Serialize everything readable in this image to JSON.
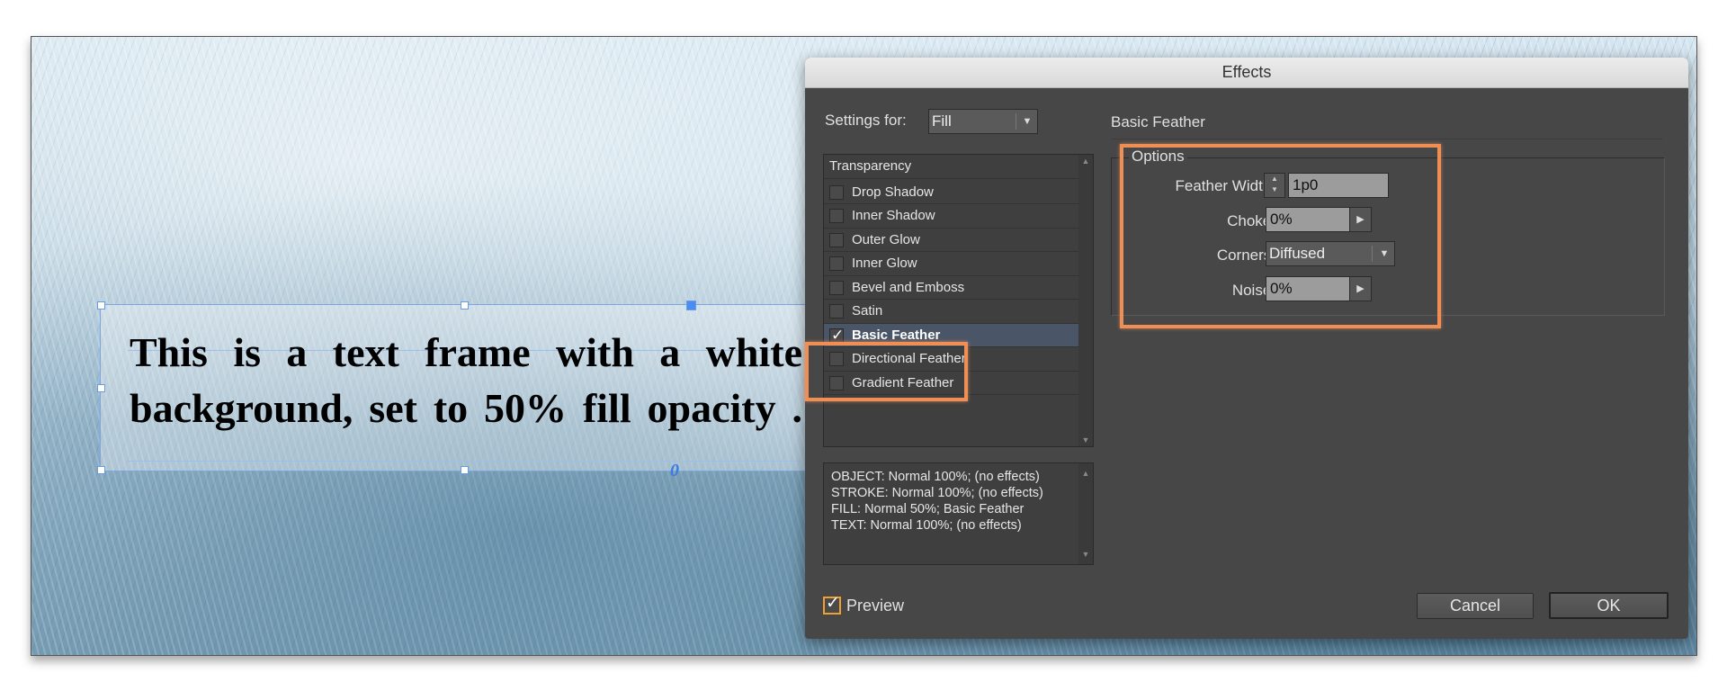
{
  "canvas": {
    "text_frame": {
      "text": "This is a text frame with a white background, set to 50% fill opacity ."
    }
  },
  "dialog": {
    "title": "Effects",
    "settings_for_label": "Settings for:",
    "settings_for_value": "Fill",
    "section_title": "Basic Feather",
    "effects_list": [
      {
        "label": "Transparency",
        "has_checkbox": false,
        "checked": false,
        "selected": false
      },
      {
        "label": "Drop Shadow",
        "has_checkbox": true,
        "checked": false,
        "selected": false
      },
      {
        "label": "Inner Shadow",
        "has_checkbox": true,
        "checked": false,
        "selected": false
      },
      {
        "label": "Outer Glow",
        "has_checkbox": true,
        "checked": false,
        "selected": false
      },
      {
        "label": "Inner Glow",
        "has_checkbox": true,
        "checked": false,
        "selected": false
      },
      {
        "label": "Bevel and Emboss",
        "has_checkbox": true,
        "checked": false,
        "selected": false
      },
      {
        "label": "Satin",
        "has_checkbox": true,
        "checked": false,
        "selected": false
      },
      {
        "label": "Basic Feather",
        "has_checkbox": true,
        "checked": true,
        "selected": true
      },
      {
        "label": "Directional Feather",
        "has_checkbox": true,
        "checked": false,
        "selected": false
      },
      {
        "label": "Gradient Feather",
        "has_checkbox": true,
        "checked": false,
        "selected": false
      }
    ],
    "summary_lines": [
      "OBJECT: Normal 100%; (no effects)",
      "STROKE: Normal 100%; (no effects)",
      "FILL: Normal 50%; Basic Feather",
      "TEXT: Normal 100%; (no effects)"
    ],
    "options": {
      "group_label": "Options",
      "feather_width_label": "Feather Width:",
      "feather_width_value": "1p0",
      "choke_label": "Choke:",
      "choke_value": "0%",
      "corners_label": "Corners:",
      "corners_value": "Diffused",
      "noise_label": "Noise:",
      "noise_value": "0%"
    },
    "preview_label": "Preview",
    "preview_checked": true,
    "cancel_label": "Cancel",
    "ok_label": "OK"
  },
  "colors": {
    "highlight": "#f08f55",
    "dialog_bg": "#474747",
    "selected_row": "#4a5667",
    "frame_selection": "#7aa6e6"
  }
}
